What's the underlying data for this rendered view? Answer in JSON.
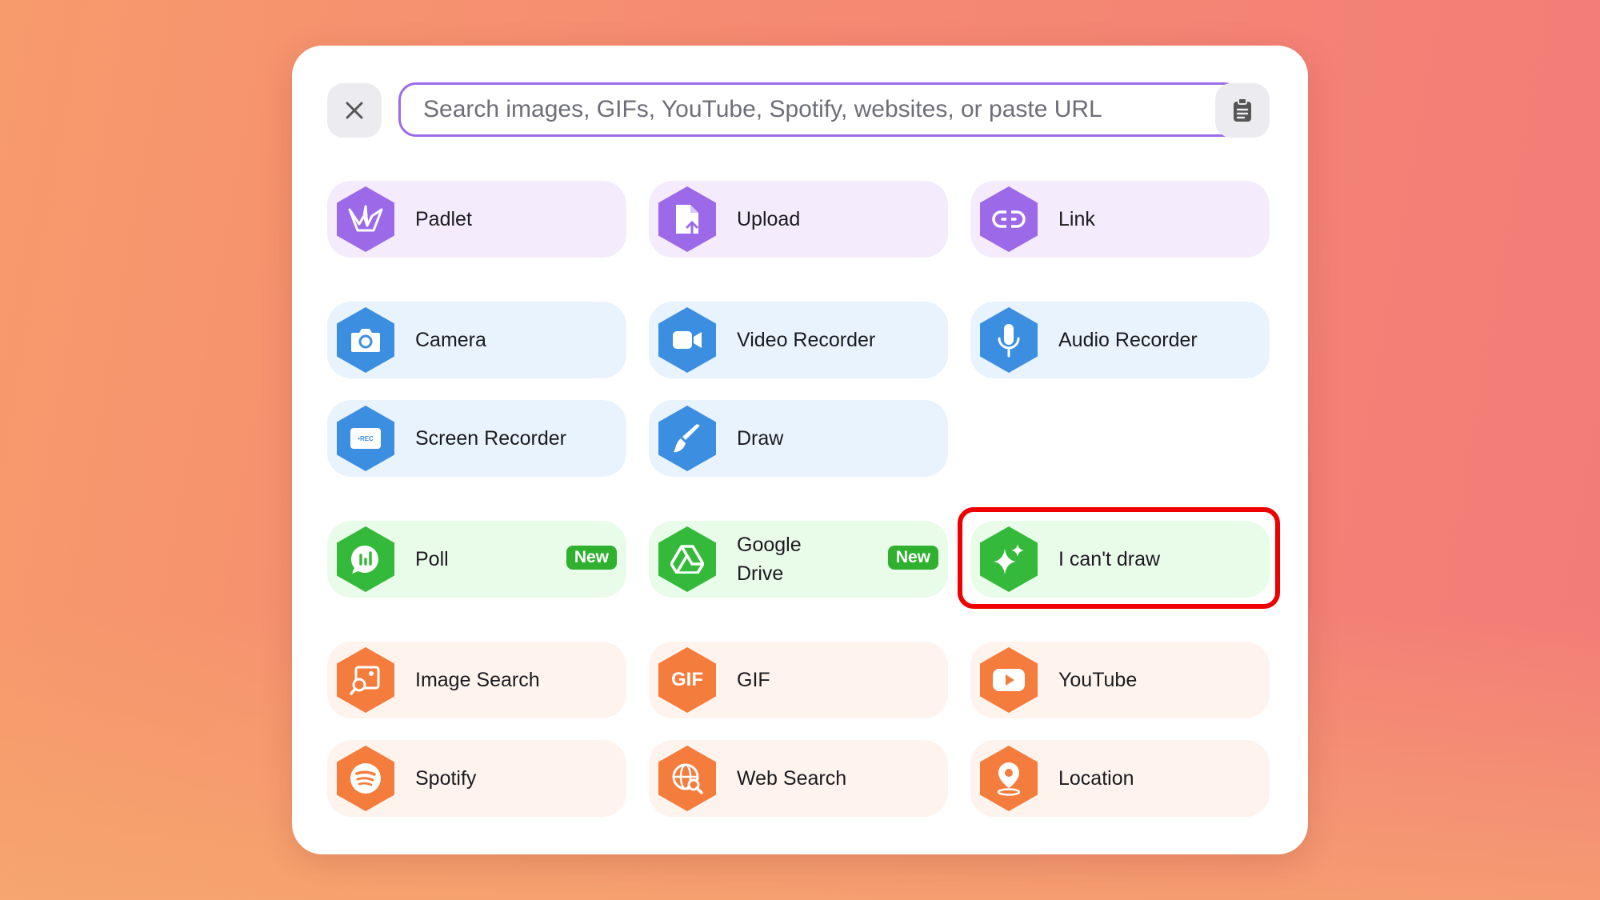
{
  "search": {
    "placeholder": "Search images, GIFs, YouTube, Spotify, websites, or paste URL",
    "value": ""
  },
  "colors": {
    "accent_border": "#9b6bea",
    "purple": "#9c6ae8",
    "blue": "#3c8fe0",
    "green": "#35b93a",
    "orange": "#f47c3c",
    "highlight": "#ee0000"
  },
  "tiles": {
    "padlet": {
      "label": "Padlet",
      "icon": "origami-crane-icon"
    },
    "upload": {
      "label": "Upload",
      "icon": "file-upload-icon"
    },
    "link": {
      "label": "Link",
      "icon": "link-icon"
    },
    "camera": {
      "label": "Camera",
      "icon": "camera-icon"
    },
    "video_recorder": {
      "label": "Video Recorder",
      "icon": "video-camera-icon"
    },
    "audio_recorder": {
      "label": "Audio Recorder",
      "icon": "microphone-icon"
    },
    "screen_recorder": {
      "label": "Screen Recorder",
      "icon": "rec-screen-icon",
      "icon_text": "•REC"
    },
    "draw": {
      "label": "Draw",
      "icon": "brush-icon"
    },
    "poll": {
      "label": "Poll",
      "icon": "poll-chart-icon",
      "badge": "New"
    },
    "google_drive": {
      "label": "Google Drive",
      "icon": "google-drive-icon",
      "badge": "New"
    },
    "cant_draw": {
      "label": "I can't draw",
      "icon": "sparkles-icon"
    },
    "image_search": {
      "label": "Image Search",
      "icon": "image-search-icon"
    },
    "gif": {
      "label": "GIF",
      "icon": "gif-icon",
      "icon_text": "GIF"
    },
    "youtube": {
      "label": "YouTube",
      "icon": "youtube-play-icon"
    },
    "spotify": {
      "label": "Spotify",
      "icon": "spotify-icon"
    },
    "web_search": {
      "label": "Web Search",
      "icon": "globe-search-icon"
    },
    "location": {
      "label": "Location",
      "icon": "location-pin-icon"
    }
  }
}
